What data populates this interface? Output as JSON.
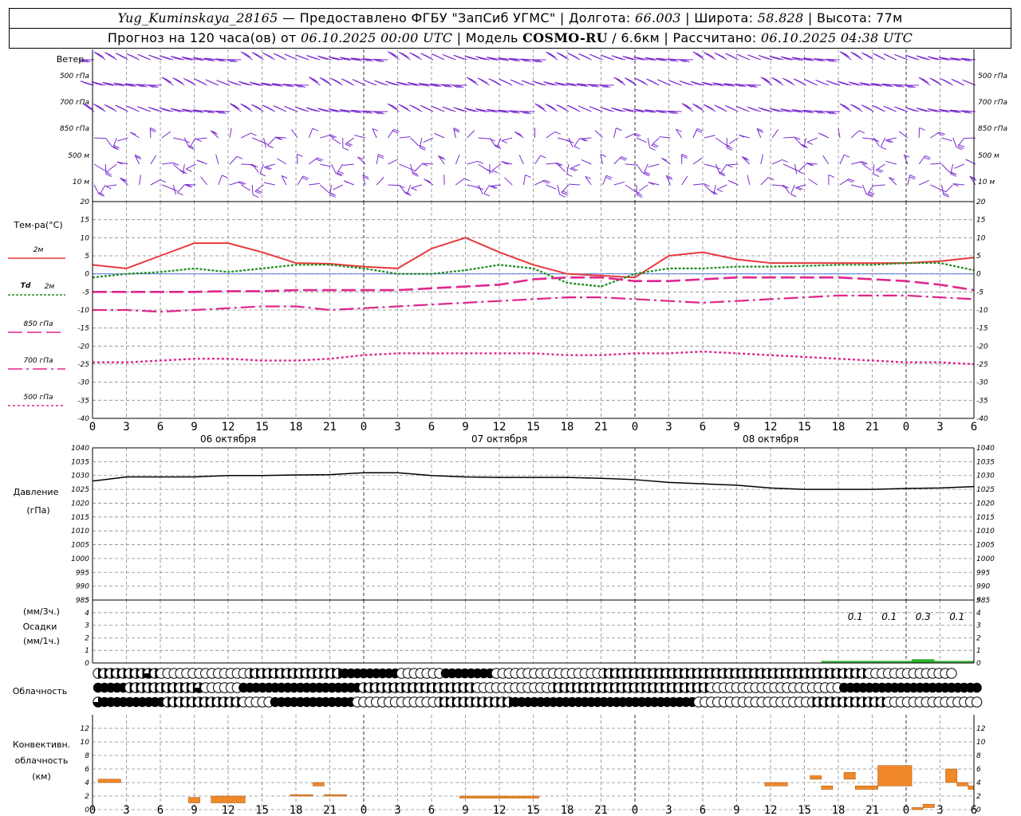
{
  "header": {
    "station": "Yug_Kuminskaya_28165",
    "provider": " — Предоставлено ФГБУ \"ЗапСиб УГМС\" | Долгота: ",
    "lon": "66.003",
    "lat_label": " | Широта: ",
    "lat": "58.828",
    "alt_label": " | Высота: 77м",
    "fc_label": "Прогноз на 120 часа(ов) от ",
    "fc_date": "06.10.2025 00:00 UTC",
    "model_label": " | Модель ",
    "model": "COSMO-RU",
    "res": " / 6.6км | Рассчитано: ",
    "calc_date": "06.10.2025 04:38 UTC"
  },
  "labels": {
    "wind": "Ветер",
    "wind_levels": [
      "500 гПа",
      "700 гПа",
      "850 гПа",
      "500 м",
      "10 м"
    ],
    "temp": "Тем-ра(°C)",
    "t2m": "2м",
    "td": "Td",
    "td2m": "2м",
    "t850": "850 гПа",
    "t700": "700 гПа",
    "t500": "500 гПа",
    "pressure": "Давление",
    "pressure_unit": "(гПа)",
    "precip_unit3": "(мм/3ч.)",
    "precip": "Осадки",
    "precip_unit1": "(мм/1ч.)",
    "cloud": "Облачность",
    "conv1": "Конвективн.",
    "conv2": "облачность",
    "conv_unit": "(км)"
  },
  "chart_data": [
    {
      "type": "line",
      "name": "temperature",
      "x_hours": [
        0,
        3,
        6,
        9,
        12,
        15,
        18,
        21,
        24,
        27,
        30,
        33,
        36,
        39,
        42,
        45,
        48,
        51,
        54,
        57,
        60,
        63,
        66,
        69,
        72,
        75,
        78
      ],
      "ylim": [
        -40,
        20
      ],
      "yticks": [
        20,
        15,
        10,
        5,
        0,
        -5,
        -10,
        -15,
        -20,
        -25,
        -30,
        -35,
        -40
      ],
      "series": [
        {
          "name": "2м",
          "color": "#e8383d",
          "values": [
            2.5,
            1.5,
            5,
            8.5,
            8.5,
            6,
            3,
            2.8,
            2,
            1.5,
            7,
            10,
            6,
            2.5,
            0,
            -0.5,
            -1,
            5,
            6,
            4,
            3,
            3,
            3,
            3,
            3,
            3.5,
            4.5
          ]
        },
        {
          "name": "Td 2м",
          "color": "#1e8a1e",
          "values": [
            -1,
            0,
            0.5,
            1.5,
            0.5,
            1.5,
            2.5,
            2.5,
            1.5,
            0,
            0,
            1,
            2.5,
            1.5,
            -2.5,
            -3.5,
            0,
            1.5,
            1.5,
            2,
            2,
            2.2,
            2.5,
            2.5,
            3,
            3,
            1
          ]
        },
        {
          "name": "850 гПа",
          "color": "#e0258c",
          "values": [
            -5,
            -5,
            -5,
            -5,
            -4.8,
            -4.8,
            -4.5,
            -4.5,
            -4.5,
            -4.5,
            -4,
            -3.5,
            -3,
            -1.5,
            -1,
            -1,
            -2,
            -2,
            -1.5,
            -1,
            -1,
            -1,
            -1,
            -1.5,
            -2,
            -3,
            -4.5
          ]
        },
        {
          "name": "700 гПа",
          "color": "#e0258c",
          "values": [
            -10,
            -10,
            -10.5,
            -10,
            -9.5,
            -9,
            -9,
            -10,
            -9.5,
            -9,
            -8.5,
            -8,
            -7.5,
            -7,
            -6.5,
            -6.5,
            -7,
            -7.5,
            -8,
            -7.5,
            -7,
            -6.5,
            -6,
            -6,
            -6,
            -6.5,
            -7
          ]
        },
        {
          "name": "500 гПа",
          "color": "#e0258c",
          "values": [
            -24.5,
            -24.5,
            -24,
            -23.5,
            -23.5,
            -24,
            -24,
            -23.5,
            -22.5,
            -22,
            -22,
            -22,
            -22,
            -22,
            -22.5,
            -22.5,
            -22,
            -22,
            -21.5,
            -22,
            -22.5,
            -23,
            -23.5,
            -24,
            -24.5,
            -24.5,
            -25
          ]
        }
      ]
    },
    {
      "type": "line",
      "name": "pressure",
      "x_hours": [
        0,
        3,
        6,
        9,
        12,
        15,
        18,
        21,
        24,
        27,
        30,
        33,
        36,
        39,
        42,
        45,
        48,
        51,
        54,
        57,
        60,
        63,
        66,
        69,
        72,
        75,
        78
      ],
      "ylim": [
        985,
        1040
      ],
      "yticks": [
        1040,
        1035,
        1030,
        1025,
        1020,
        1015,
        1010,
        1005,
        1000,
        995,
        990,
        985
      ],
      "series": [
        {
          "name": "pressure",
          "color": "#000000",
          "values": [
            1028,
            1029.5,
            1029.5,
            1029.5,
            1030,
            1030,
            1030.2,
            1030.3,
            1031,
            1031,
            1030,
            1029.5,
            1029.3,
            1029.3,
            1029.3,
            1029,
            1028.5,
            1027.5,
            1027,
            1026.5,
            1025.5,
            1025,
            1025,
            1025,
            1025.3,
            1025.5,
            1026
          ]
        }
      ]
    },
    {
      "type": "bar",
      "name": "precipitation",
      "ylim": [
        0,
        5
      ],
      "yticks": [
        5,
        4,
        3,
        2,
        1,
        0
      ],
      "labels_3h": [
        "0.1",
        "0.1",
        "0.3",
        "0.1"
      ],
      "label_hours": [
        67.5,
        70.5,
        73.5,
        76.5
      ]
    },
    {
      "type": "bar",
      "name": "convective_cloud",
      "ylim": [
        0,
        14
      ],
      "yticks": [
        12,
        10,
        8,
        6,
        4,
        2,
        0
      ],
      "unit": "км",
      "segments": [
        {
          "x0": 0.5,
          "x1": 2.5,
          "y0": 4,
          "y1": 4.5
        },
        {
          "x0": 8.5,
          "x1": 9.5,
          "y0": 1,
          "y1": 1.8
        },
        {
          "x0": 10.5,
          "x1": 13.5,
          "y0": 1,
          "y1": 2
        },
        {
          "x0": 17.5,
          "x1": 19.5,
          "y0": 2,
          "y1": 2.2
        },
        {
          "x0": 19.5,
          "x1": 20.5,
          "y0": 3.5,
          "y1": 4
        },
        {
          "x0": 20.5,
          "x1": 22.5,
          "y0": 2,
          "y1": 2.2
        },
        {
          "x0": 32.5,
          "x1": 36.5,
          "y0": 1.7,
          "y1": 2
        },
        {
          "x0": 36.5,
          "x1": 39.5,
          "y0": 1.7,
          "y1": 2
        },
        {
          "x0": 59.5,
          "x1": 61.5,
          "y0": 3.5,
          "y1": 4
        },
        {
          "x0": 63.5,
          "x1": 64.5,
          "y0": 4.5,
          "y1": 5
        },
        {
          "x0": 64.5,
          "x1": 65.5,
          "y0": 3,
          "y1": 3.5
        },
        {
          "x0": 66.5,
          "x1": 67.5,
          "y0": 4.5,
          "y1": 5.5
        },
        {
          "x0": 67.5,
          "x1": 69.5,
          "y0": 3,
          "y1": 3.5
        },
        {
          "x0": 69.5,
          "x1": 72.5,
          "y0": 3.5,
          "y1": 6.5
        },
        {
          "x0": 72.5,
          "x1": 73.5,
          "y0": 0,
          "y1": 0.3
        },
        {
          "x0": 73.5,
          "x1": 74.5,
          "y0": 0.3,
          "y1": 0.8
        },
        {
          "x0": 75.5,
          "x1": 76.5,
          "y0": 4,
          "y1": 6
        },
        {
          "x0": 76.5,
          "x1": 77.5,
          "y0": 3.5,
          "y1": 4
        },
        {
          "x0": 77.5,
          "x1": 78,
          "y0": 3,
          "y1": 3.5
        }
      ]
    }
  ],
  "x_axis": {
    "ticks": [
      "0",
      "3",
      "6",
      "9",
      "12",
      "15",
      "18",
      "21",
      "0",
      "3",
      "6",
      "9",
      "12",
      "15",
      "18",
      "21",
      "0",
      "3",
      "6",
      "9",
      "12",
      "15",
      "18",
      "21",
      "0",
      "3",
      "6"
    ],
    "dates": [
      "06 октября",
      "07 октября",
      "08 октября"
    ]
  },
  "clouds": {
    "rows": [
      "hhhhhhhhthqqqqqqqqqqqqqqhhhhhhhhhhhhhhhfffffffffqqqqqqqffffffffqqqqqqqqqqqqqqqqqhhhhhhhhhhhhhhhhhhhhhhhhhhhhhhhhhhhhhhhhhhqqqqqqqqqqqqqq",
      "fffffhhhhhhhhhhhtqqqqqqfffffffffffffffffffhhhhhhhhhhhhhhhhhhqqqqqqqqqqqqhhhhhhhhhhhhhhhhhhhhhhhhhqqqqqqqqqqqqqqqqqqqqqffffffffffffffffffffffff",
      "tffffffffffhhhhhhhhhhhhqqqqqfffffffffffffqqqqqqqqqqqqqhhhhhhhhhhhhfffffffffffffffffffffffffffffqqqqqqqqqqqqqqqqqqhhhhhhhhhhhhqqqqqqqqqqqqqqqq"
    ]
  },
  "wind_color": "#7a2bcf",
  "grid_color": "#8a8a8a"
}
